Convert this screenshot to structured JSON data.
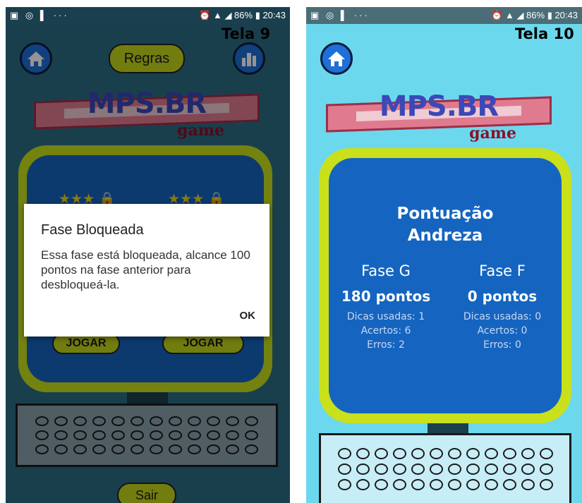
{
  "status_bar": {
    "left_icons": "▣ ◎ ▌ ···",
    "right_text": "⏰ ▲ ◢ 86% ▮ 20:43"
  },
  "screen9": {
    "tela_label": "Tela 9",
    "rules_button": "Regras",
    "logo_text": "MPS.BR",
    "logo_sub": "game",
    "stars_left": "★★★ 🔒",
    "stars_right": "★★★ 🔒",
    "play_left": "JOGAR",
    "play_right": "JOGAR",
    "exit_button": "Sair",
    "dialog": {
      "title": "Fase Bloqueada",
      "message": "Essa fase está bloqueada, alcance 100 pontos na fase anterior para desbloqueá-la.",
      "ok": "OK"
    }
  },
  "screen10": {
    "tela_label": "Tela 10",
    "logo_text": "MPS.BR",
    "logo_sub": "game",
    "score_title": "Pontuação",
    "player_name": "Andreza",
    "phases": [
      {
        "name": "Fase G",
        "points": "180 pontos",
        "hints": "Dicas usadas: 1",
        "hits": "Acertos: 6",
        "errors": "Erros: 2"
      },
      {
        "name": "Fase F",
        "points": "0 pontos",
        "hints": "Dicas usadas: 0",
        "hits": "Acertos: 0",
        "errors": "Erros: 0"
      }
    ]
  },
  "colors": {
    "screen9_bg": "#2c6d86",
    "screen10_bg": "#6cd8ee",
    "frame_yellow": "#c9e01a",
    "panel_blue": "#1565c0",
    "button_blue": "#1e6fd9",
    "pill_yellow": "#c4d81a"
  },
  "icons": [
    "home-icon",
    "bar-chart-icon",
    "lock-icon",
    "star-icon"
  ]
}
